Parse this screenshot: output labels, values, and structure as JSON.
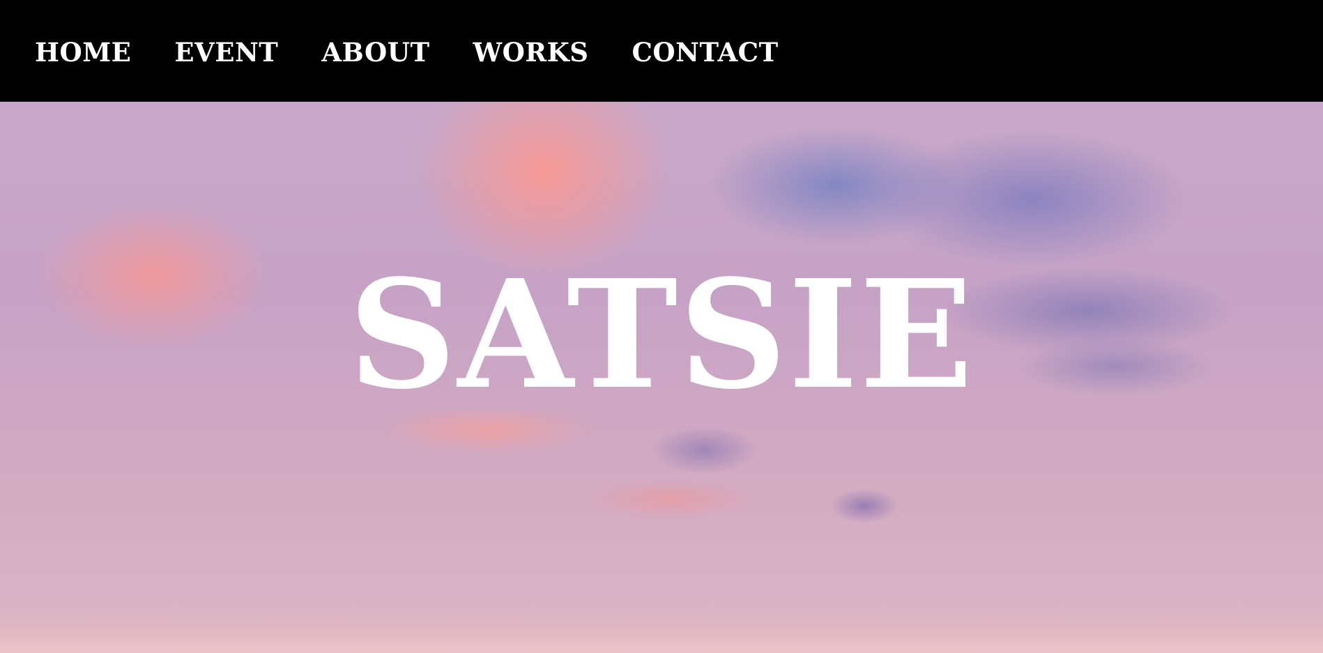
{
  "nav": {
    "items": [
      {
        "label": "HOME"
      },
      {
        "label": "EVENT"
      },
      {
        "label": "ABOUT"
      },
      {
        "label": "WORKS"
      },
      {
        "label": "CONTACT"
      }
    ]
  },
  "hero": {
    "title": "SATSIE",
    "background": "sky-sunset-image"
  },
  "colors": {
    "navbar_bg": "#000000",
    "nav_text": "#ffffff",
    "hero_title": "#ffffff"
  }
}
